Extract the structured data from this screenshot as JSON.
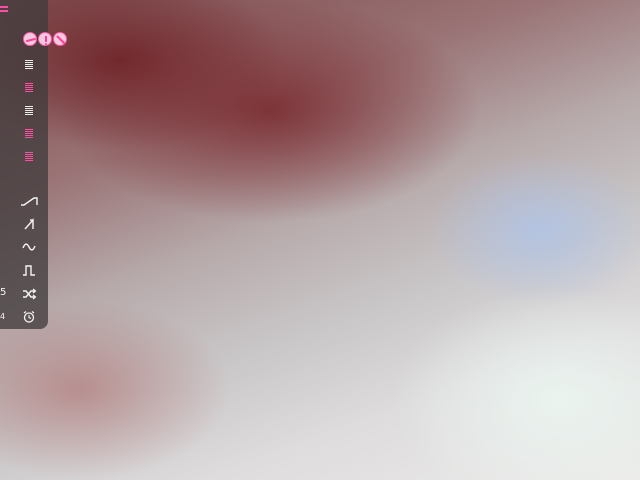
{
  "left_labels": {
    "a": "5",
    "b": "4"
  },
  "toolbar": {
    "menu_icon": "hamburger-menu-icon",
    "round_buttons": [
      "minus-circle-icon",
      "info-circle-icon",
      "slash-circle-icon"
    ],
    "level_strips": [
      {
        "id": "strip-1",
        "color": "#ececec"
      },
      {
        "id": "strip-2",
        "color": "#ff4fa3"
      },
      {
        "id": "strip-3",
        "color": "#ececec"
      },
      {
        "id": "strip-4",
        "color": "#ff4fa3"
      },
      {
        "id": "strip-5",
        "color": "#ff4fa3"
      }
    ],
    "waveforms": [
      "ramp-wave-icon",
      "sawtooth-wave-icon",
      "sine-wave-icon",
      "square-wave-icon",
      "random-shuffle-icon",
      "alarm-clock-icon"
    ]
  },
  "colors": {
    "accent": "#ff4fa3",
    "panel": "#3f3a3c",
    "icon": "#f4f4f4"
  }
}
